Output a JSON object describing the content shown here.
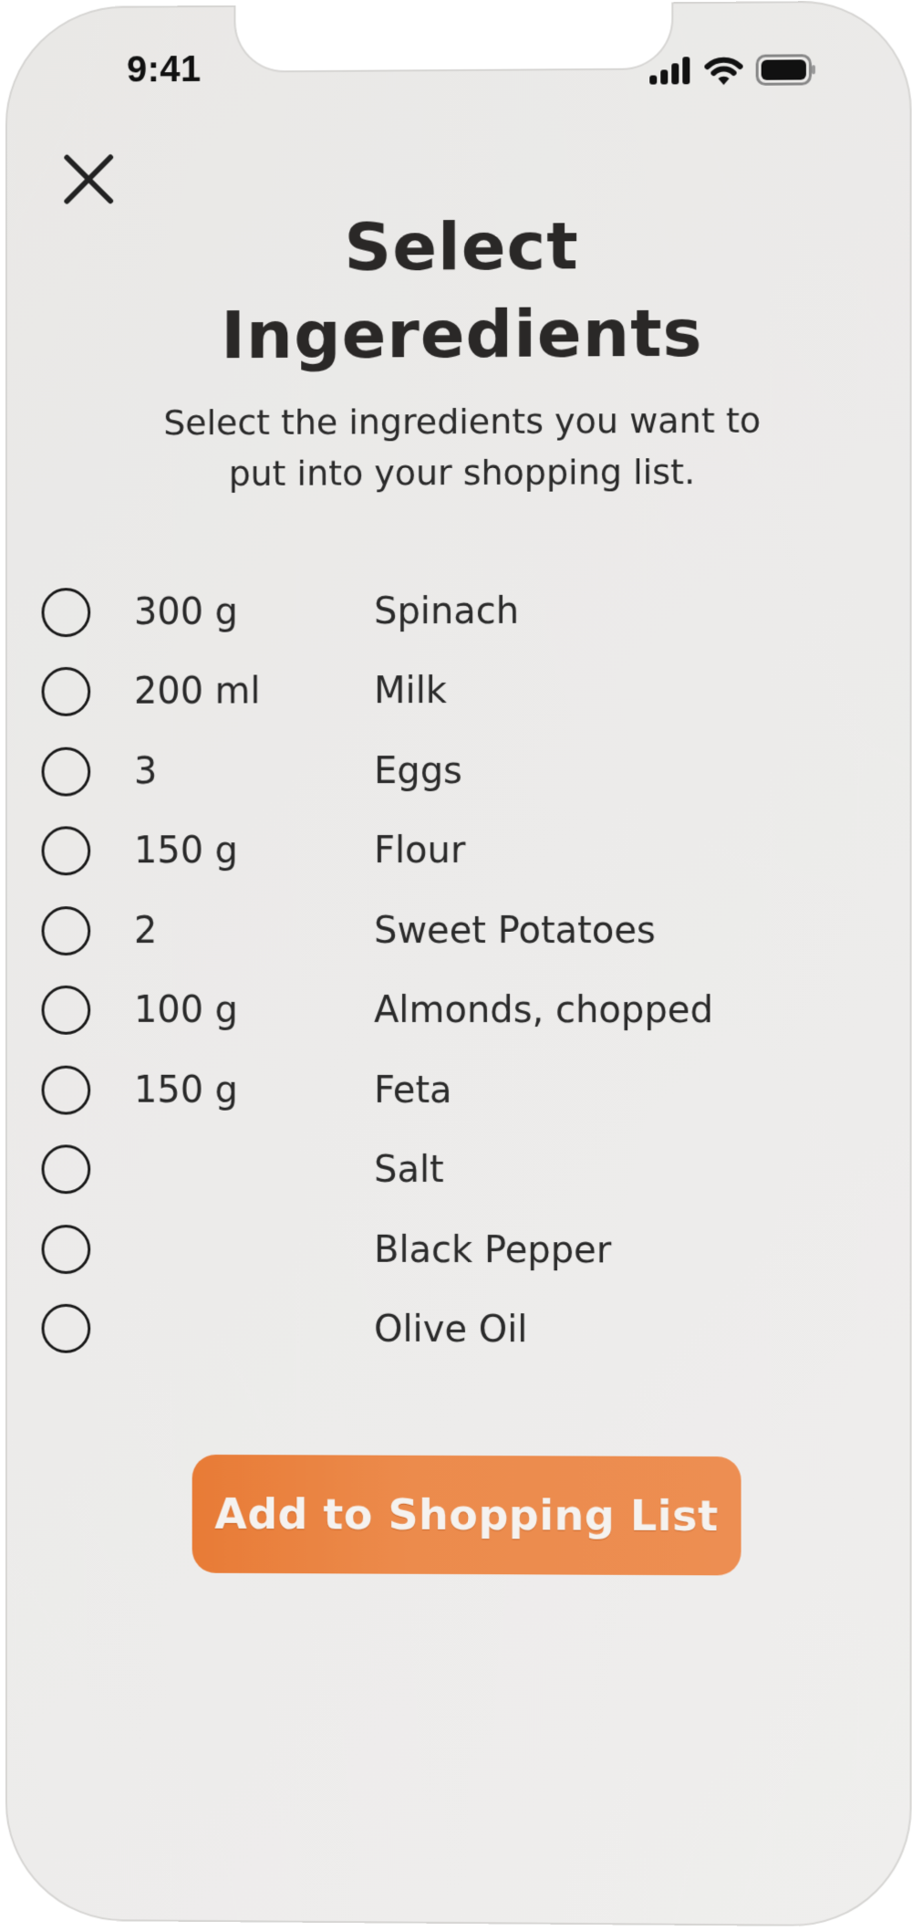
{
  "status_bar": {
    "time": "9:41",
    "icons": [
      "cellular-signal-icon",
      "wifi-icon",
      "battery-icon"
    ]
  },
  "header": {
    "close_icon": "close-icon",
    "title_line1": "Select",
    "title_line2": "Ingeredients",
    "subtitle_line1": "Select the ingredients you want to",
    "subtitle_line2": "put into your shopping list."
  },
  "ingredients": [
    {
      "quantity": "300 g",
      "name": "Spinach",
      "selected": false
    },
    {
      "quantity": "200 ml",
      "name": "Milk",
      "selected": false
    },
    {
      "quantity": "3",
      "name": "Eggs",
      "selected": false
    },
    {
      "quantity": "150 g",
      "name": "Flour",
      "selected": false
    },
    {
      "quantity": "2",
      "name": "Sweet Potatoes",
      "selected": false
    },
    {
      "quantity": "100 g",
      "name": "Almonds, chopped",
      "selected": false
    },
    {
      "quantity": "150 g",
      "name": "Feta",
      "selected": false
    },
    {
      "quantity": "",
      "name": "Salt",
      "selected": false
    },
    {
      "quantity": "",
      "name": "Black Pepper",
      "selected": false
    },
    {
      "quantity": "",
      "name": "Olive Oil",
      "selected": false
    }
  ],
  "actions": {
    "add_button_label": "Add to Shopping List",
    "accent_color": "#EA8444"
  }
}
